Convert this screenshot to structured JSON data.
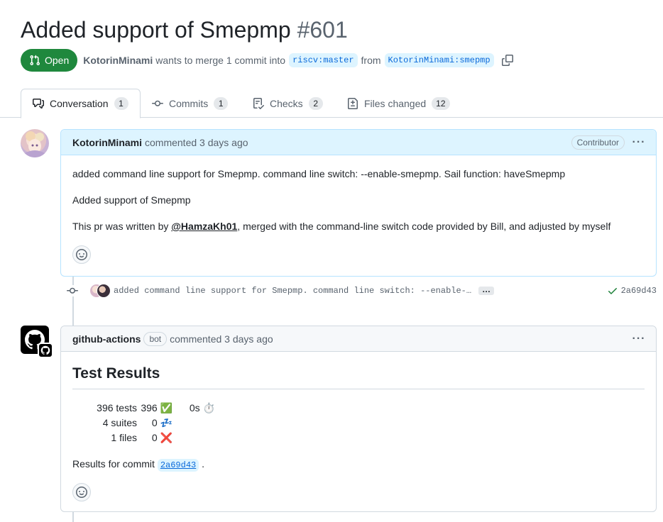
{
  "pr": {
    "title": "Added support of Smepmp",
    "number": "#601",
    "state": "Open",
    "author": "KotorinMinami",
    "merge_text": "wants to merge 1 commit into",
    "base_branch": "riscv:master",
    "from_text": "from",
    "head_branch": "KotorinMinami:smepmp"
  },
  "tabs": [
    {
      "label": "Conversation",
      "count": "1",
      "icon": "comment-discussion-icon"
    },
    {
      "label": "Commits",
      "count": "1",
      "icon": "git-commit-icon"
    },
    {
      "label": "Checks",
      "count": "2",
      "icon": "checklist-icon"
    },
    {
      "label": "Files changed",
      "count": "12",
      "icon": "file-diff-icon"
    }
  ],
  "comment1": {
    "author": "KotorinMinami",
    "when": "commented 3 days ago",
    "badge": "Contributor",
    "body": {
      "p1": "added command line support for Smepmp. command line switch: --enable-smepmp. Sail function: haveSmepmp",
      "p2": "Added support of Smepmp",
      "p3_before": "This pr was written by ",
      "mention": "@HamzaKh01",
      "p3_after": ", merged with the command-line switch code provided by Bill, and adjusted by myself"
    }
  },
  "commit": {
    "message": "added command line support for Smepmp. command line switch: --enable-…",
    "ellipsis": "…",
    "sha": "2a69d43"
  },
  "comment2": {
    "author": "github-actions",
    "badge": "bot",
    "when": "commented 3 days ago",
    "results_title": "Test Results",
    "rows": [
      {
        "label": "396 tests",
        "value": "396",
        "emoji": "✅",
        "extra": "0s",
        "extra_emoji": "⏱️"
      },
      {
        "label": "4 suites",
        "value": "0",
        "emoji": "💤",
        "extra": "",
        "extra_emoji": ""
      },
      {
        "label": "1 files",
        "value": "0",
        "emoji": "❌",
        "extra": "",
        "extra_emoji": ""
      }
    ],
    "results_for": "Results for commit",
    "sha": "2a69d43",
    "after_sha": "."
  },
  "colors": {
    "open_green": "#1f883d",
    "link_blue": "#0969da",
    "highlight_bg": "#ddf4ff"
  }
}
